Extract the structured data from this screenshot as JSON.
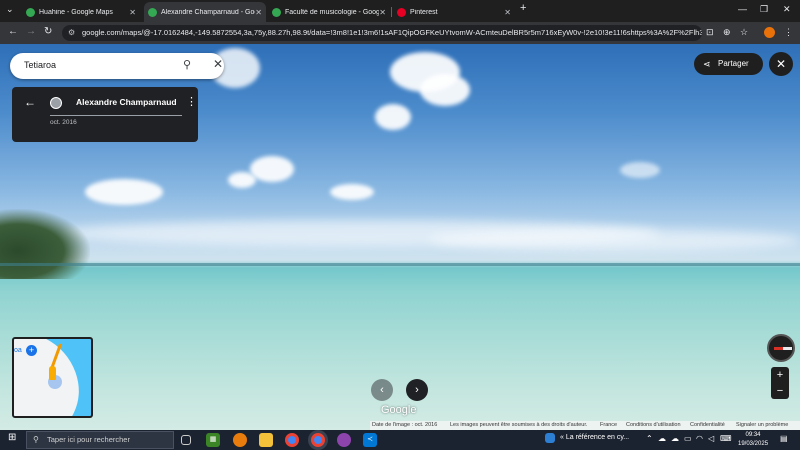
{
  "browser": {
    "tabs": [
      {
        "title": "Huahine - Google Maps",
        "icon": "maps-pin-icon",
        "active": false
      },
      {
        "title": "Alexandre Champarnaud - Goo",
        "icon": "maps-pin-icon",
        "active": true
      },
      {
        "title": "Faculté de musicologie - Goog",
        "icon": "maps-pin-icon",
        "active": false
      },
      {
        "title": "Pinterest",
        "icon": "pinterest-icon",
        "active": false
      }
    ],
    "url": "google.com/maps/@-17.0162484,-149.5872554,3a,75y,88.27h,98.9t/data=!3m8!1e1!3m6!1sAF1QipOGFKeUYtvomW-ACmteuDelBR5r5m716xEyW0v-!2e10!3e11!6shttps%3A%2F%2Flh3.googleuser..."
  },
  "maps": {
    "search_value": "Tetiaroa",
    "contributor_name": "Alexandre Champarnaud",
    "capture_date": "oct. 2016",
    "share_label": "Partager",
    "minimap_label": "oa",
    "google_logo": "Google",
    "attribution": {
      "image_date": "Date de l'image : oct. 2016",
      "rights": "Les images peuvent être soumises à des droits d'auteur.",
      "country": "France",
      "terms": "Conditions d'utilisation",
      "privacy": "Confidentialité",
      "report": "Signaler un problème"
    }
  },
  "taskbar": {
    "search_placeholder": "Taper ici pour rechercher",
    "news": "« La référence en cy...",
    "time": "09:34",
    "date": "19/03/2025"
  },
  "colors": {
    "accent_blue": "#1a73e8",
    "peg_yellow": "#f9ab00",
    "chrome_dark": "#35363a"
  }
}
